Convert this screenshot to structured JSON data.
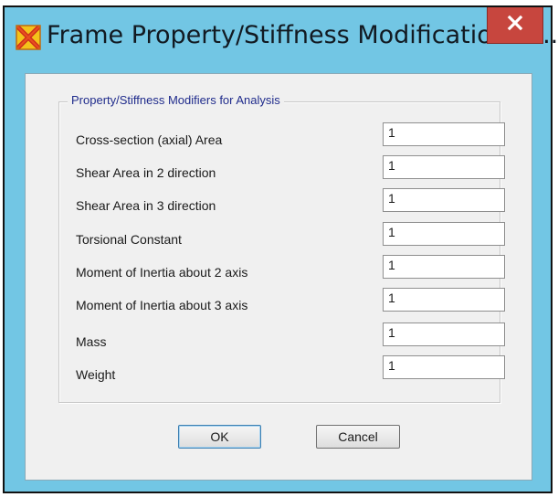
{
  "window": {
    "title": "Frame Property/Stiffness Modification Fa..."
  },
  "icons": {
    "app": "sap2000-app-icon",
    "close": "close-icon"
  },
  "colors": {
    "titlebar": "#72c6e4",
    "close_button": "#c7463e",
    "dialog_background": "#f0f0f0",
    "group_title": "#202c8c"
  },
  "group": {
    "title": "Property/Stiffness Modifiers for Analysis"
  },
  "modifiers": [
    {
      "label": "Cross-section (axial) Area",
      "value": "1"
    },
    {
      "label": "Shear Area in 2 direction",
      "value": "1"
    },
    {
      "label": "Shear Area in 3 direction",
      "value": "1"
    },
    {
      "label": "Torsional Constant",
      "value": "1"
    },
    {
      "label": "Moment of Inertia about 2 axis",
      "value": "1"
    },
    {
      "label": "Moment of Inertia about 3 axis",
      "value": "1"
    },
    {
      "label": "Mass",
      "value": "1"
    },
    {
      "label": "Weight",
      "value": "1"
    }
  ],
  "buttons": {
    "ok": "OK",
    "cancel": "Cancel"
  }
}
